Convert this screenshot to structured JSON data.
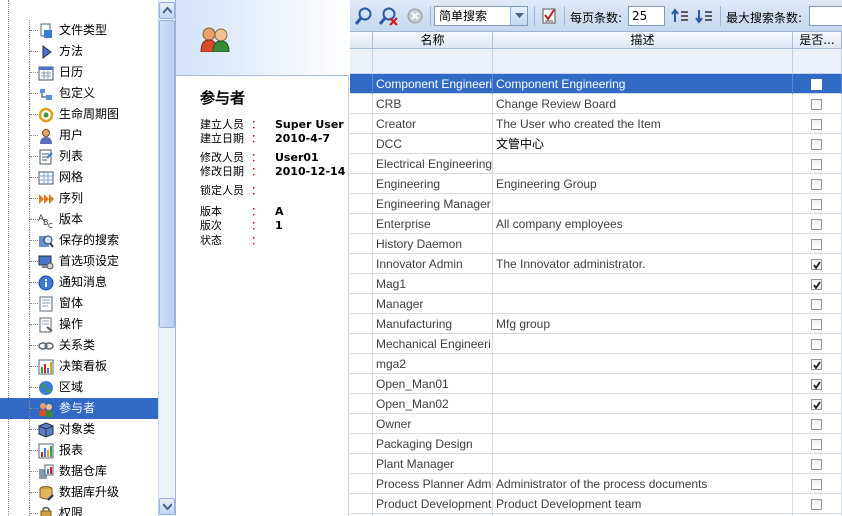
{
  "tree": {
    "items": [
      {
        "label": "文件类型",
        "icon": "file-type-icon"
      },
      {
        "label": "方法",
        "icon": "method-icon"
      },
      {
        "label": "日历",
        "icon": "calendar-icon"
      },
      {
        "label": "包定义",
        "icon": "package-icon"
      },
      {
        "label": "生命周期图",
        "icon": "lifecycle-icon"
      },
      {
        "label": "用户",
        "icon": "user-icon"
      },
      {
        "label": "列表",
        "icon": "list-icon"
      },
      {
        "label": "网格",
        "icon": "grid-icon"
      },
      {
        "label": "序列",
        "icon": "sequence-icon"
      },
      {
        "label": "版本",
        "icon": "revision-icon"
      },
      {
        "label": "保存的搜索",
        "icon": "saved-search-icon"
      },
      {
        "label": "首选项设定",
        "icon": "preferences-icon"
      },
      {
        "label": "通知消息",
        "icon": "info-icon"
      },
      {
        "label": "窗体",
        "icon": "form-icon"
      },
      {
        "label": "操作",
        "icon": "action-icon"
      },
      {
        "label": "关系类",
        "icon": "relationship-icon"
      },
      {
        "label": "决策看板",
        "icon": "dashboard-icon"
      },
      {
        "label": "区域",
        "icon": "globe-icon"
      },
      {
        "label": "参与者",
        "icon": "identity-icon",
        "selected": true
      },
      {
        "label": "对象类",
        "icon": "itemtype-icon"
      },
      {
        "label": "报表",
        "icon": "report-icon"
      },
      {
        "label": "数据仓库",
        "icon": "warehouse-icon"
      },
      {
        "label": "数据库升级",
        "icon": "database-upgrade-icon"
      },
      {
        "label": "权限",
        "icon": "permission-icon"
      }
    ]
  },
  "detail": {
    "title": "参与者",
    "props": [
      {
        "label": "建立人员",
        "colon": "：",
        "value": "Super User"
      },
      {
        "label": "建立日期",
        "colon": "：",
        "value": "2010-4-7"
      },
      {
        "label": "修改人员",
        "colon": "：",
        "value": "User01"
      },
      {
        "label": "修改日期",
        "colon": "：",
        "value": "2010-12-14"
      },
      {
        "label": "锁定人员",
        "colon": "：",
        "value": ""
      },
      {
        "label": "版本",
        "colon": "：",
        "value": "A"
      },
      {
        "label": "版次",
        "colon": "：",
        "value": "1"
      },
      {
        "label": "状态",
        "colon": "：",
        "value": ""
      }
    ]
  },
  "toolbar": {
    "search_mode": "简单搜索",
    "page_size_label": "每页条数:",
    "page_size_value": "25",
    "max_search_label": "最大搜索条数:"
  },
  "grid": {
    "columns": [
      "名称",
      "描述",
      "是否..."
    ],
    "rows": [
      {
        "name": "Component Engineering",
        "desc": "Component Engineering",
        "checked": false,
        "selected": true
      },
      {
        "name": "CRB",
        "desc": "Change Review Board",
        "checked": false
      },
      {
        "name": "Creator",
        "desc": "The User who created the Item",
        "checked": false
      },
      {
        "name": "DCC",
        "desc": "文管中心",
        "checked": false
      },
      {
        "name": "Electrical Engineering",
        "desc": "",
        "checked": false
      },
      {
        "name": "Engineering",
        "desc": "Engineering Group",
        "checked": false
      },
      {
        "name": "Engineering Manager",
        "desc": "",
        "checked": false
      },
      {
        "name": "Enterprise",
        "desc": "All company employees",
        "checked": false
      },
      {
        "name": "History Daemon",
        "desc": "",
        "checked": false
      },
      {
        "name": "Innovator Admin",
        "desc": "The Innovator administrator.",
        "checked": true
      },
      {
        "name": "Mag1",
        "desc": "",
        "checked": true
      },
      {
        "name": "Manager",
        "desc": "",
        "checked": false
      },
      {
        "name": "Manufacturing",
        "desc": "Mfg group",
        "checked": false
      },
      {
        "name": "Mechanical Engineeri...",
        "desc": "",
        "checked": false
      },
      {
        "name": "mga2",
        "desc": "",
        "checked": true
      },
      {
        "name": "Open_Man01",
        "desc": "",
        "checked": true
      },
      {
        "name": "Open_Man02",
        "desc": "",
        "checked": true
      },
      {
        "name": "Owner",
        "desc": "",
        "checked": false
      },
      {
        "name": "Packaging Design",
        "desc": "",
        "checked": false
      },
      {
        "name": "Plant Manager",
        "desc": "",
        "checked": false
      },
      {
        "name": "Process Planner Admin",
        "desc": "Administrator of the process documents",
        "checked": false
      },
      {
        "name": "Product Development",
        "desc": "Product Development team",
        "checked": false
      },
      {
        "name": "",
        "desc": "",
        "checked": false
      }
    ]
  }
}
